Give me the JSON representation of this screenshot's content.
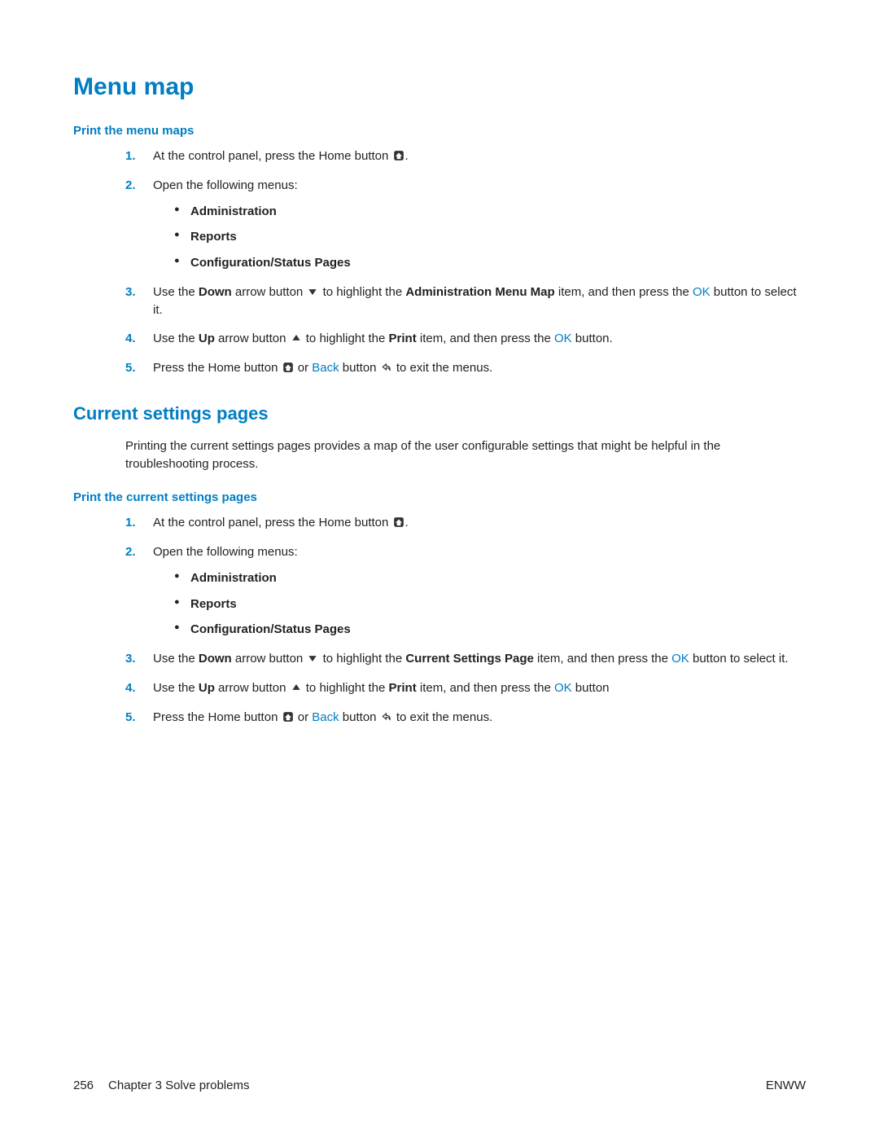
{
  "heading_1": "Menu map",
  "sub_1": "Print the menu maps",
  "s1_step1_a": "At the control panel, press the Home button ",
  "s1_step1_b": ".",
  "s1_step2": "Open the following menus:",
  "menus": {
    "m1": "Administration",
    "m2": "Reports",
    "m3": "Configuration/Status Pages"
  },
  "s1_step3_a": "Use the ",
  "s1_step3_b": "Down",
  "s1_step3_c": " arrow button ",
  "s1_step3_d": " to highlight the ",
  "s1_step3_e": "Administration Menu Map",
  "s1_step3_f": " item, and then press the ",
  "s1_step3_g": "OK",
  "s1_step3_h": " button to select it.",
  "s1_step4_a": "Use the ",
  "s1_step4_b": "Up",
  "s1_step4_c": " arrow button ",
  "s1_step4_d": " to highlight the ",
  "s1_step4_e": "Print",
  "s1_step4_f": " item, and then press the ",
  "s1_step4_g": "OK",
  "s1_step4_h": " button.",
  "s1_step5_a": "Press the Home button ",
  "s1_step5_b": " or ",
  "s1_step5_c": "Back",
  "s1_step5_d": " button ",
  "s1_step5_e": " to exit the menus.",
  "heading_2": "Current settings pages",
  "intro_2": "Printing the current settings pages provides a map of the user configurable settings that might be helpful in the troubleshooting process.",
  "sub_2": "Print the current settings pages",
  "s2_step3_a": "Use the ",
  "s2_step3_b": "Down",
  "s2_step3_c": " arrow button ",
  "s2_step3_d": " to highlight the ",
  "s2_step3_e": "Current Settings Page",
  "s2_step3_f": " item, and then press the ",
  "s2_step3_g": "OK",
  "s2_step3_h": " button to select it.",
  "s2_step4_a": "Use the ",
  "s2_step4_b": "Up",
  "s2_step4_c": " arrow button ",
  "s2_step4_d": " to highlight the ",
  "s2_step4_e": "Print",
  "s2_step4_f": " item, and then press the ",
  "s2_step4_g": "OK",
  "s2_step4_h": " button",
  "num1": "1.",
  "num2": "2.",
  "num3": "3.",
  "num4": "4.",
  "num5": "5.",
  "footer": {
    "page_num": "256",
    "chapter": "Chapter 3   Solve problems",
    "right": "ENWW"
  }
}
